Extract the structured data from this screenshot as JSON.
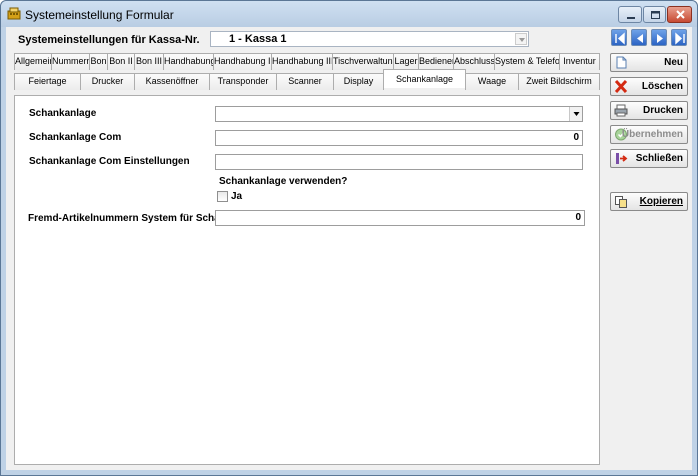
{
  "window": {
    "title": "Systemeinstellung Formular"
  },
  "header": {
    "kassa_label": "Systemeinstellungen für Kassa-Nr.",
    "kassa_value": "1 - Kassa 1"
  },
  "tabs": {
    "row1": [
      "Allgemein",
      "Nummern",
      "Bon",
      "Bon II",
      "Bon III",
      "Handhabung",
      "Handhabung II",
      "Handhabung III",
      "Tischverwaltung",
      "Lager",
      "Bediener",
      "Abschluss",
      "System & Telefon",
      "Inventur"
    ],
    "row2": [
      "Feiertage",
      "Drucker",
      "Kassenöffner",
      "Transponder",
      "Scanner",
      "Display",
      "Schankanlage",
      "Waage",
      "Zweit Bildschirm"
    ],
    "active": "Schankanlage"
  },
  "form": {
    "schankanlage_label": "Schankanlage",
    "schankanlage_value": "",
    "com_label": "Schankanlage Com",
    "com_value": "0",
    "com_settings_label": "Schankanlage Com Einstellungen",
    "com_settings_value": "",
    "use_question": "Schankanlage verwenden?",
    "use_checkbox_label": "Ja",
    "use_checked": false,
    "fremd_label": "Fremd-Artikelnummern System für Schank",
    "fremd_value": "0"
  },
  "sidebar": {
    "neu": "Neu",
    "loeschen": "Löschen",
    "drucken": "Drucken",
    "uebernehmen": "Übernehmen",
    "schliessen": "Schließen",
    "kopieren": "Kopieren"
  }
}
